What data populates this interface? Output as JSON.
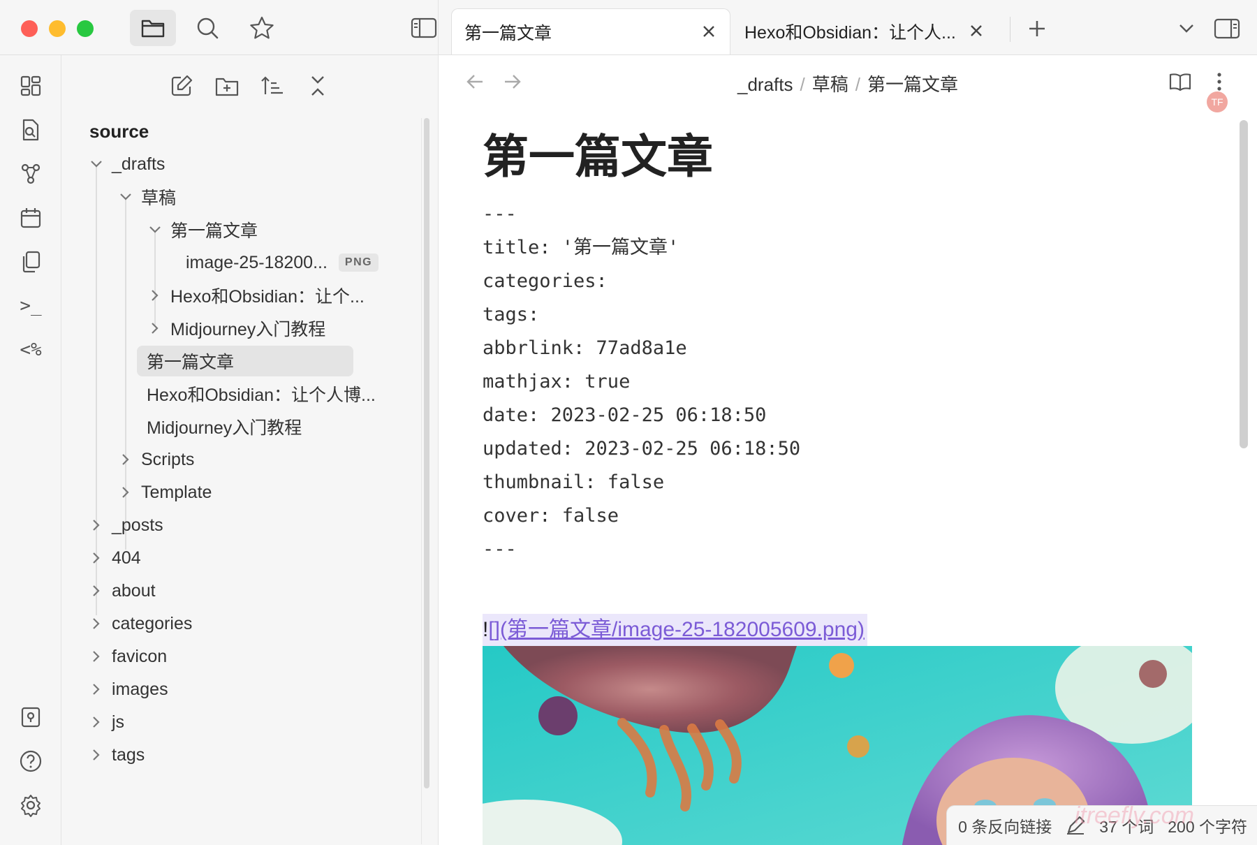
{
  "window": {
    "toolbar_left": {
      "icons": [
        "folder-icon",
        "search-icon",
        "star-icon",
        "sidebar-toggle-icon"
      ]
    },
    "ribbon": {
      "icons": [
        "dashboard-icon",
        "file-search-icon",
        "graph-icon",
        "calendar-icon",
        "copy-icon",
        "terminal-icon",
        "templater-icon",
        "vault-icon",
        "help-icon",
        "settings-icon"
      ],
      "templater_label": "<%",
      "terminal_label": ">_"
    }
  },
  "explorer": {
    "tools": [
      "new-note-icon",
      "new-folder-icon",
      "sort-icon",
      "collapse-all-icon"
    ],
    "root": "source",
    "items": {
      "drafts": "_drafts",
      "caogao": "草稿",
      "first_folder": "第一篇文章",
      "image_file": "image-25-18200...",
      "image_badge": "PNG",
      "hexo_folder": "Hexo和Obsidian：让个...",
      "mj_folder": "Midjourney入门教程",
      "first_note": "第一篇文章",
      "hexo_note": "Hexo和Obsidian：让个人博...",
      "mj_note": "Midjourney入门教程",
      "scripts": "Scripts",
      "template": "Template",
      "posts": "_posts",
      "f404": "404",
      "about": "about",
      "categories": "categories",
      "favicon": "favicon",
      "images": "images",
      "js": "js",
      "tags": "tags"
    }
  },
  "tabs": [
    {
      "label": "第一篇文章",
      "active": true
    },
    {
      "label": "Hexo和Obsidian：让个人...",
      "active": false
    }
  ],
  "breadcrumb": {
    "part1": "_drafts",
    "part2": "草稿",
    "part3": "第一篇文章",
    "sep": "/"
  },
  "avatar": "TF",
  "note": {
    "title": "第一篇文章",
    "frontmatter": [
      "---",
      "title: '第一篇文章'",
      "categories:",
      "tags:",
      "abbrlink: 77ad8a1e",
      "mathjax: true",
      "date: 2023-02-25 06:18:50",
      "updated: 2023-02-25 06:18:50",
      "thumbnail: false",
      "cover: false",
      "---"
    ],
    "image_link_bang": "!",
    "image_link": "[](第一篇文章/image-25-182005609.png)"
  },
  "status": {
    "backlinks": "0 条反向链接",
    "words": "37 个词",
    "chars": "200 个字符",
    "watermark": "itreefly.com"
  },
  "colors": {
    "link": "#7b5bd6",
    "link_bg": "#ebe7fb",
    "close_red": "#fe5f57",
    "minimize_yellow": "#febc2e",
    "zoom_green": "#28c840"
  }
}
